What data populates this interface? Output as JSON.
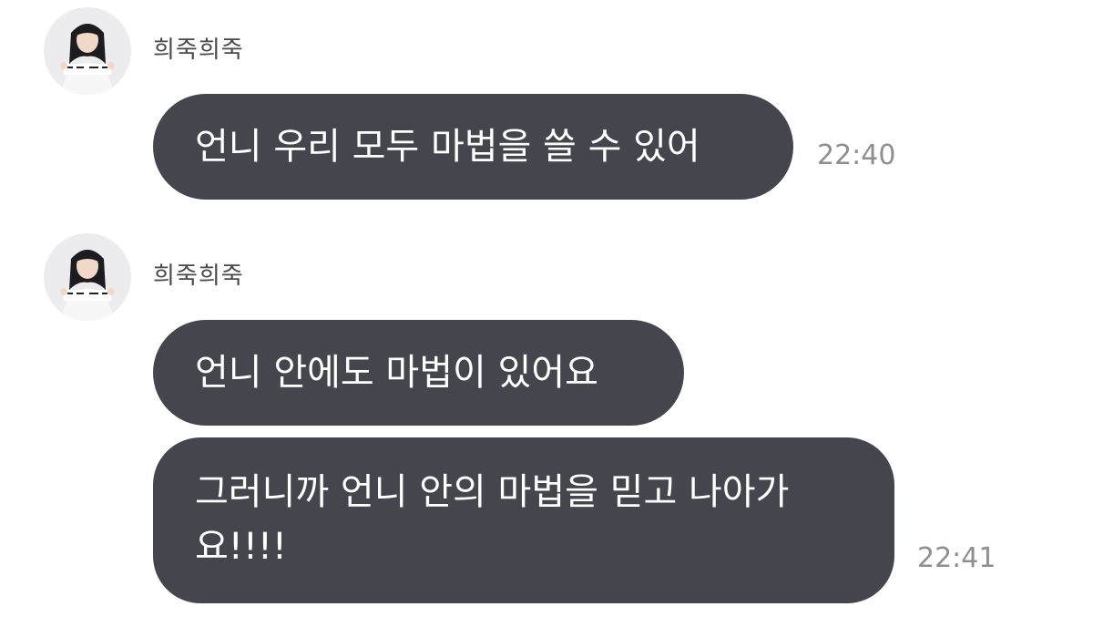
{
  "messages": [
    {
      "sender": "희죽희죽",
      "text": "언니 우리 모두 마법을 쓸 수 있어",
      "time": "22:40"
    },
    {
      "sender": "희죽희죽",
      "bubbles": [
        "언니 안에도 마법이 있어요",
        "그러니까 언니 안의 마법을 믿고 나아가 요!!!!"
      ],
      "time": "22:41"
    }
  ],
  "avatar_icon": "profile-photo",
  "colors": {
    "bubble": "#45464d",
    "bubble_text": "#ffffff",
    "sender": "#4a4a4e",
    "time": "#8e8e93",
    "background": "#ffffff"
  }
}
